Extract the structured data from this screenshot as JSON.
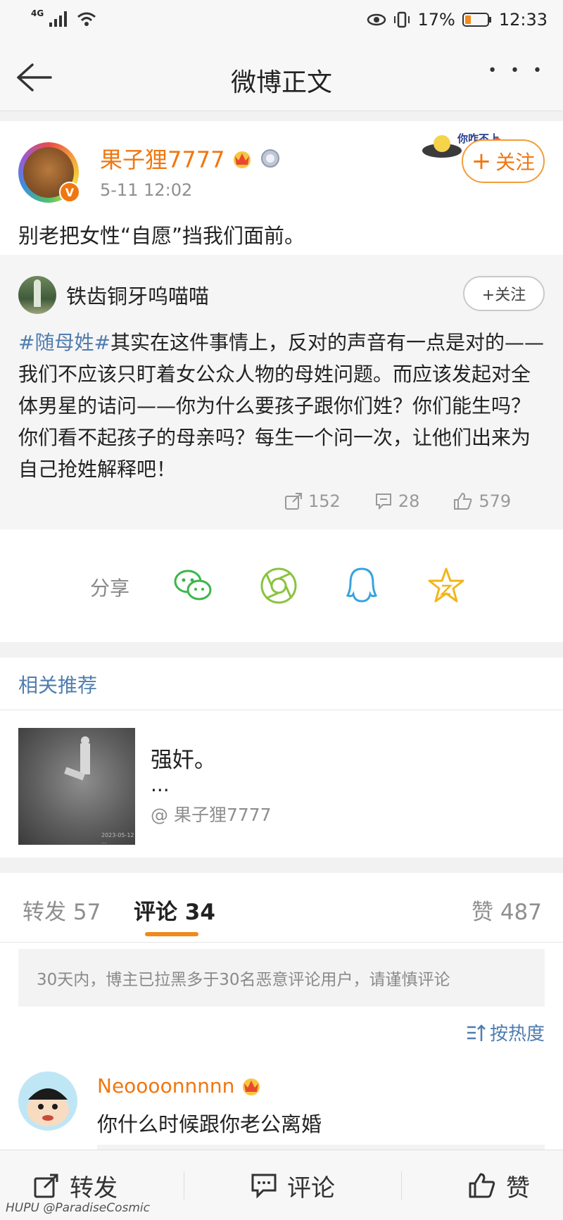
{
  "status": {
    "network": "4G",
    "battery_pct": "17%",
    "time": "12:33"
  },
  "nav": {
    "title": "微博正文",
    "more": "• • •"
  },
  "post": {
    "author": "果子狸7777",
    "time": "5-11 12:02",
    "follow_label": "关注",
    "follow_plus": "+",
    "text": "别老把女性“自愿”挡我们面前。",
    "sticker_text": "你咋不上"
  },
  "repost": {
    "author": "铁齿铜牙呜喵喵",
    "follow_label": "+关注",
    "hashtag": "#随母姓#",
    "text": "其实在这件事情上，反对的声音有一点是对的——我们不应该只盯着女公众人物的母姓问题。而应该发起对全体男星的诘问——你为什么要孩子跟你们姓？你们能生吗？你们看不起孩子的母亲吗？每生一个问一次，让他们出来为自己抢姓解释吧！",
    "reposts": "152",
    "comments": "28",
    "likes": "579"
  },
  "share": {
    "label": "分享"
  },
  "recommend": {
    "header": "相关推荐",
    "title": "强奸。",
    "ellipsis": "...",
    "author": "@ 果子狸7777",
    "thumb_caption": "2023-05-12 ..."
  },
  "tabs": {
    "repost_label": "转发 57",
    "comment_label": "评论 34",
    "like_label": "赞 487",
    "notice": "30天内，博主已拉黑多于30名恶意评论用户，请谨慎评论",
    "sort_label": "按热度"
  },
  "comment": {
    "author": "Neoooonnnnn",
    "text": "你什么时候跟你老公离婚"
  },
  "bottom": {
    "repost": "转发",
    "comment": "评论",
    "like": "赞",
    "watermark": "HUPU @ParadiseCosmic"
  },
  "colors": {
    "accent_orange": "#f0770f",
    "link_blue": "#507daf",
    "tab_underline": "#f08a1c"
  }
}
